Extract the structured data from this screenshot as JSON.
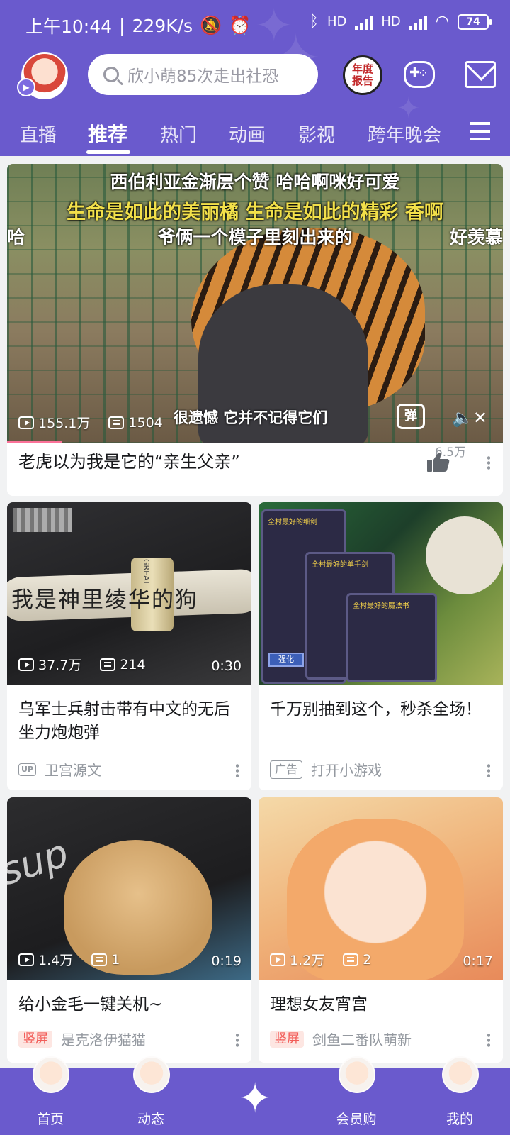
{
  "status_bar": {
    "time": "上午10:44",
    "speed": "229K/s",
    "hd1": "HD",
    "hd2": "HD",
    "battery": "74"
  },
  "header": {
    "search_placeholder": "欣小萌85次走出社恐",
    "report_badge_line1": "年度",
    "report_badge_line2": "报告"
  },
  "tabs": [
    "直播",
    "推荐",
    "热门",
    "动画",
    "影视",
    "跨年晚会"
  ],
  "hero": {
    "subtitles": {
      "line1": "西伯利亚金渐层个赞 哈哈啊咪好可爱",
      "line2": "生命是如此的美丽橘 生命是如此的精彩 香啊",
      "line3": "爷俩一个模子里刻出来的",
      "line3_right": "好羡慕",
      "line3_left": "哈",
      "bottom": "很遗憾 它并不记得它们"
    },
    "views": "155.1万",
    "danmaku": "1504",
    "danmaku_button": "弹",
    "title": "老虎以为我是它的“亲生父亲”",
    "likes": "6.5万",
    "progress": 0.11
  },
  "cards": [
    {
      "views": "37.7万",
      "danmaku": "214",
      "duration": "0:30",
      "title": "乌军士兵射击带有中文的无后坐力炮炮弹",
      "thumb_text_main": "我是神里绫华的狗",
      "thumb_text_label": "GREAT",
      "tag": "UP",
      "author": "卫宫源文"
    },
    {
      "title": "千万别抽到这个，秒杀全场！",
      "tag": "广告",
      "author": "打开小游戏",
      "game": {
        "panel1_title": "全村最好的细剑",
        "panel2_title": "全村最好的单手剑",
        "panel3_title": "全村最好的魔法书",
        "button": "强化"
      }
    },
    {
      "views": "1.4万",
      "danmaku": "1",
      "duration": "0:19",
      "title": "给小金毛一键关机~",
      "tag": "竖屏",
      "author": "是克洛伊猫猫",
      "thumb_text": "sup"
    },
    {
      "views": "1.2万",
      "danmaku": "2",
      "duration": "0:17",
      "title": "理想女友宵宫",
      "tag": "竖屏",
      "author": "剑鱼二番队萌新"
    }
  ],
  "bottom_nav": [
    "首页",
    "动态",
    "会员购",
    "我的"
  ],
  "colors": {
    "brand": "#6a5acd",
    "accent_pink": "#fb7299",
    "vertical_tag": "#f25d59"
  }
}
